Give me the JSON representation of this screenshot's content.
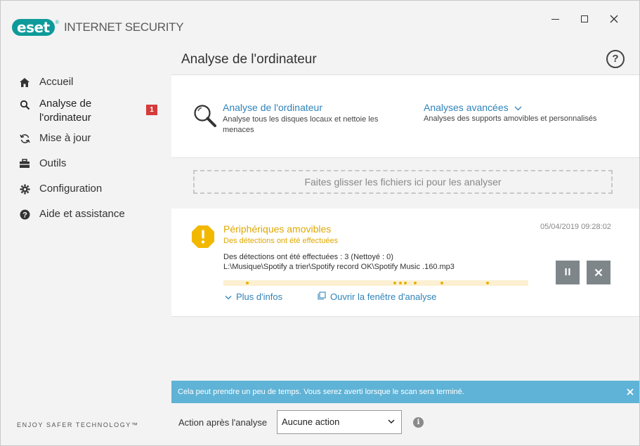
{
  "app": {
    "logo_text": "eset",
    "logo_reg": "®",
    "product_name": "INTERNET SECURITY",
    "brand_color": "#0e9a9a"
  },
  "window_controls": [
    "minimize-icon",
    "maximize-icon",
    "close-icon"
  ],
  "sidebar": {
    "items": [
      {
        "label": "Accueil",
        "icon": "home-icon"
      },
      {
        "label": "Analyse de l'ordinateur",
        "icon": "search-icon",
        "badge": "1"
      },
      {
        "label": "Mise à jour",
        "icon": "refresh-icon"
      },
      {
        "label": "Outils",
        "icon": "toolbox-icon"
      },
      {
        "label": "Configuration",
        "icon": "gear-icon"
      },
      {
        "label": "Aide et assistance",
        "icon": "help-icon"
      }
    ],
    "tagline": "ENJOY SAFER TECHNOLOGY™"
  },
  "main": {
    "title": "Analyse de l'ordinateur",
    "help_label": "?",
    "scan": {
      "title": "Analyse de l'ordinateur",
      "description": "Analyse tous les disques locaux et nettoie les menaces"
    },
    "advanced": {
      "title": "Analyses avancées",
      "description": "Analyses des supports amovibles et personnalisés"
    },
    "dropzone_text": "Faites glisser les fichiers ici pour les analyser",
    "result": {
      "title": "Périphériques amovibles",
      "subtitle": "Des détections ont été effectuées",
      "date": "05/04/2019 09:28:02",
      "detail_line1": "Des détections ont été effectuées : 3 (Nettoyé : 0)",
      "detail_line2": "L:\\Musique\\Spotify a trier\\Spotify record OK\\Spotify  Music .160.mp3",
      "more_info": "Plus d'infos",
      "open_window": "Ouvrir la fenêtre d'analyse",
      "warning_color": "#e0a800"
    },
    "infobar_text": "Cela peut prendre un peu de temps. Vous serez averti lorsque le scan sera terminé.",
    "action_label": "Action après l'analyse",
    "action_value": "Aucune action"
  }
}
